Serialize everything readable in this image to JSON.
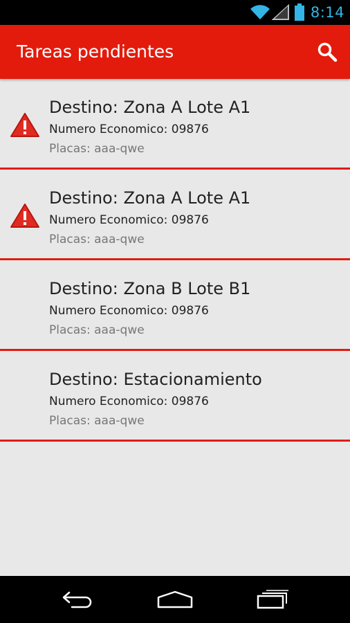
{
  "status_bar": {
    "time": "8:14",
    "icons": [
      "wifi-icon",
      "signal-icon",
      "battery-icon"
    ],
    "time_color": "#33b5e5"
  },
  "action_bar": {
    "title": "Tareas pendientes",
    "background": "#e31b0c",
    "search_icon": "search-icon"
  },
  "tasks": [
    {
      "destino": "Destino: Zona A Lote A1",
      "numero": "Numero Economico: 09876",
      "placas": "Placas: aaa-qwe",
      "warning": true
    },
    {
      "destino": "Destino: Zona A Lote A1",
      "numero": "Numero Economico: 09876",
      "placas": "Placas: aaa-qwe",
      "warning": true
    },
    {
      "destino": "Destino: Zona B Lote B1",
      "numero": "Numero Economico: 09876",
      "placas": "Placas: aaa-qwe",
      "warning": false
    },
    {
      "destino": "Destino: Estacionamiento",
      "numero": "Numero Economico: 09876",
      "placas": "Placas: aaa-qwe",
      "warning": false
    }
  ],
  "nav_bar": {
    "icons": [
      "back-icon",
      "home-icon",
      "recent-apps-icon"
    ]
  },
  "colors": {
    "accent": "#e31b0c",
    "divider": "#e01c0e",
    "warning": "#e02b22",
    "list_background": "#e8e8e8"
  }
}
